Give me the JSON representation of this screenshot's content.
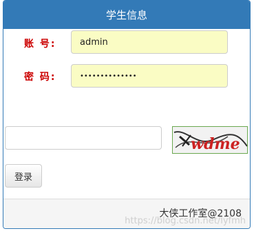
{
  "panel": {
    "title": "学生信息"
  },
  "form": {
    "username_label": "账 号:",
    "username_value": "admin",
    "password_label": "密 码:",
    "password_value": "••••••••••••••",
    "captcha_input_value": "",
    "captcha_text": "wdme",
    "login_label": "登录"
  },
  "footer": {
    "text": "大侠工作室@2108",
    "watermark": "https://blog.csdn.net/lyfmh"
  },
  "colors": {
    "primary": "#337ab7",
    "label_red": "#cc0000",
    "input_filled": "#fafcc4"
  }
}
